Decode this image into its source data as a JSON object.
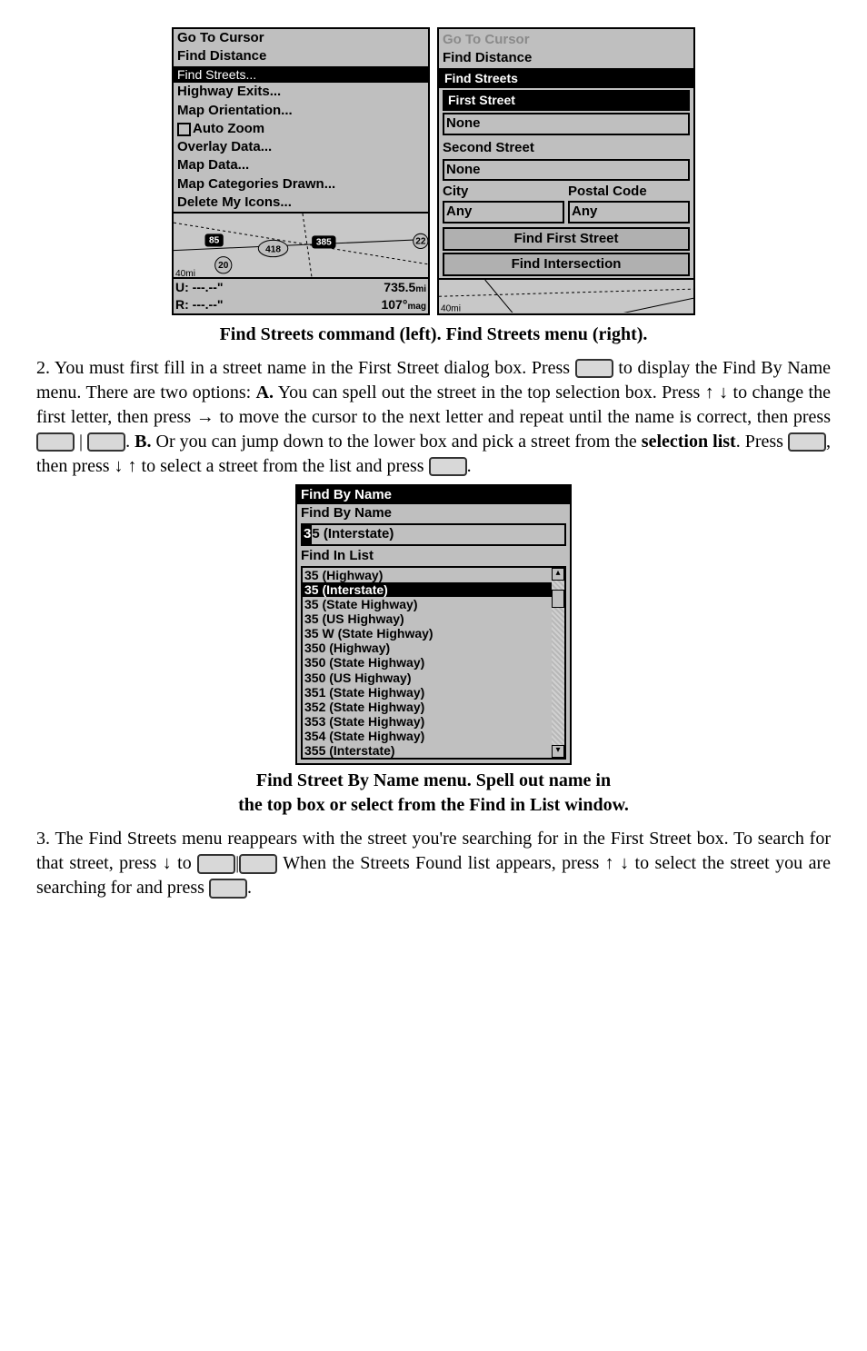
{
  "figure1": {
    "menu": [
      "Go To Cursor",
      "Find Distance",
      "Find Streets...",
      "Highway Exits...",
      "Map Orientation...",
      "Auto Zoom",
      "Overlay Data...",
      "Map Data...",
      "Map Categories Drawn...",
      "Delete My Icons..."
    ],
    "map": {
      "shields": [
        "85",
        "418",
        "385",
        "22",
        "20"
      ],
      "scale": "40mi"
    },
    "coords": {
      "u": "U:  ---.--\"",
      "r": "R:  ---.--\"",
      "dist": "735.5",
      "dist_unit": "mi",
      "heading": "107°",
      "heading_unit": "mag"
    }
  },
  "figure1b": {
    "dim1": "Go To Cursor",
    "dim2": "Find Distance",
    "bar": "Find Streets",
    "label_first": "First Street",
    "val_first": "None",
    "label_second": "Second Street",
    "val_second": "None",
    "city_h": "City",
    "city_v": "Any",
    "postal_h": "Postal Code",
    "postal_v": "Any",
    "btn1": "Find First Street",
    "btn2": "Find Intersection",
    "scale": "40mi"
  },
  "caption1": "Find Streets command (left). Find Streets menu (right).",
  "para1_a": "2. You must first fill in a street name in the First Street dialog box. Press ",
  "para1_b": " to display the Find By Name menu. There are two options: ",
  "para1_c": "A.",
  "para1_d": " You can spell out the street in the top selection box. Press ↑ ↓ to change the first letter, then press → to move the cursor to the next letter and repeat until the name is correct, then press ",
  "para1_e": " | ",
  "para1_f": ". ",
  "para1_g": "B.",
  "para1_h": " Or you can jump down to the lower box and pick a street from the ",
  "para1_i": "selection list",
  "para1_j": ". Press ",
  "para1_k": ", then press ↓ ↑ to select a street from the list and press ",
  "para1_l": ".",
  "figure2": {
    "title": "Find By Name",
    "subtitle": "Find By Name",
    "typed_cursor": "3",
    "typed_rest": "5 (Interstate)",
    "list_label": "Find In List",
    "items": [
      "35 (Highway)",
      "35 (Interstate)",
      "35 (State Highway)",
      "35 (US Highway)",
      "35 W (State Highway)",
      "350 (Highway)",
      "350 (State Highway)",
      "350 (US Highway)",
      "351 (State Highway)",
      "352 (State Highway)",
      "353 (State Highway)",
      "354 (State Highway)",
      "355 (Interstate)"
    ],
    "selected_index": 1
  },
  "caption2a": "Find Street By Name menu. Spell out name in",
  "caption2b": "the top box or select from the Find in List window.",
  "para2_a": "3. The Find Streets menu reappears with the street you're searching for in the First Street box. To search for that street, press ↓ to ",
  "para2_b": "|",
  "para2_c": " When the Streets Found list appears, press ↑ ↓ to select the street you are searching for and press ",
  "para2_d": "."
}
